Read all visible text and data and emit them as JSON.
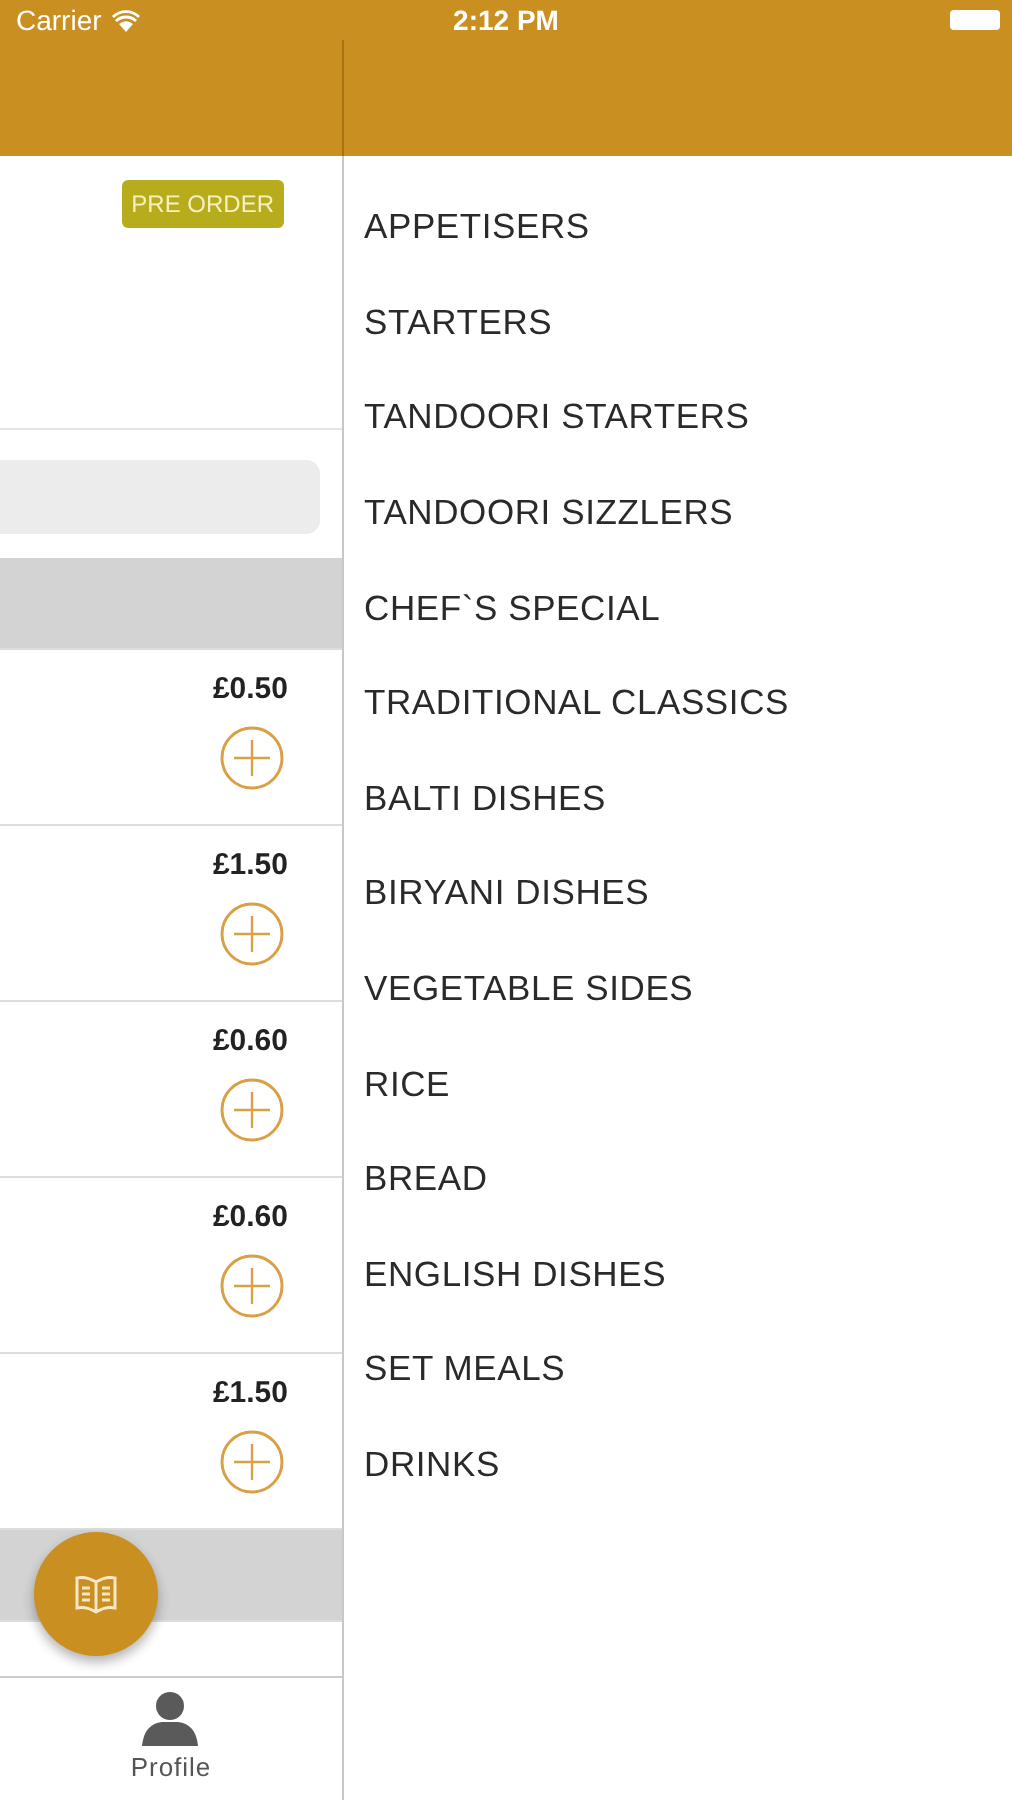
{
  "status_bar": {
    "carrier": "Carrier",
    "time": "2:12 PM"
  },
  "order_panel": {
    "badge": "PRE ORDER",
    "rows": [
      {
        "kind": "section"
      },
      {
        "kind": "item",
        "price": "£0.50"
      },
      {
        "kind": "item",
        "price": "£1.50"
      },
      {
        "kind": "item",
        "price": "£0.60"
      },
      {
        "kind": "item",
        "price": "£0.60"
      },
      {
        "kind": "item",
        "price": "£1.50"
      },
      {
        "kind": "section"
      }
    ],
    "tab_bar": {
      "label": "Profile"
    }
  },
  "categories": [
    "APPETISERS",
    "STARTERS",
    "TANDOORI STARTERS",
    "TANDOORI SIZZLERS",
    "CHEF`S SPECIAL",
    "TRADITIONAL CLASSICS",
    "BALTI DISHES",
    "BIRYANI DISHES",
    "VEGETABLE SIDES",
    "RICE",
    "BREAD",
    "ENGLISH DISHES",
    "SET MEALS",
    "DRINKS"
  ]
}
